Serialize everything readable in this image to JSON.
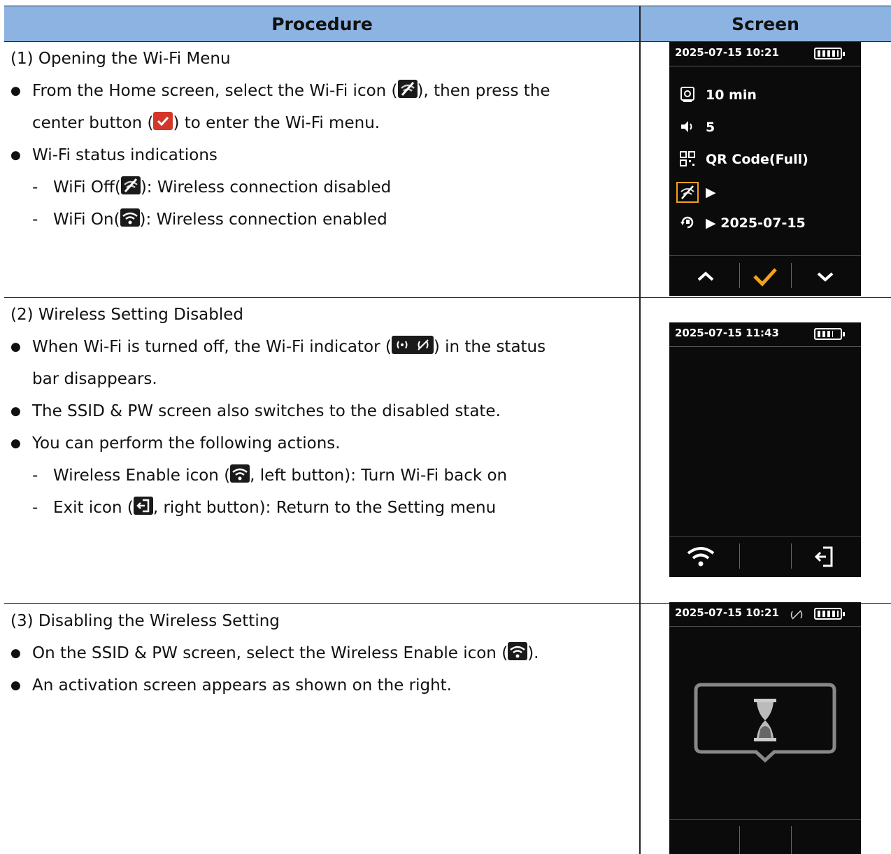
{
  "table": {
    "header_procedure": "Procedure",
    "header_screen": "Screen"
  },
  "sections": [
    {
      "title": "(1) Opening the Wi-Fi Menu",
      "b1_a": "From the Home screen, select the Wi-Fi icon (",
      "b1_b": "), then press the",
      "b1_c": "center button (",
      "b1_d": ") to enter the Wi-Fi menu.",
      "b2": "Wi-Fi status indications",
      "d1_a": "WiFi Off(",
      "d1_b": "): Wireless connection disabled",
      "d2_a": "WiFi On(",
      "d2_b": "): Wireless connection enabled"
    },
    {
      "title": "(2) Wireless Setting Disabled",
      "b1_a": "When Wi-Fi is turned off, the Wi-Fi indicator (",
      "b1_b": ") in the status",
      "b1_c": "bar disappears.",
      "b2": "The SSID & PW screen also switches to the disabled state.",
      "b3": "You can perform the following actions.",
      "d1_a": "Wireless Enable icon (",
      "d1_b": ", left button): Turn Wi-Fi back on",
      "d2_a": "Exit icon (",
      "d2_b": ", right button): Return to the Setting menu"
    },
    {
      "title": "(3) Disabling the Wireless Setting",
      "b1_a": "On the SSID & PW screen, select the Wireless Enable icon (",
      "b1_b": ").",
      "b2": "An activation screen appears as shown on the right."
    }
  ],
  "screens": {
    "s1": {
      "datetime": "2025-07-15 10:21",
      "menu_timeout": "10 min",
      "menu_volume": "5",
      "menu_qr": "QR Code(Full)",
      "menu_date": "2025-07-15"
    },
    "s2": {
      "datetime": "2025-07-15 11:43"
    },
    "s3": {
      "datetime": "2025-07-15 10:21"
    }
  },
  "colors": {
    "header_bg": "#8db3e2",
    "accent": "#f5a21a",
    "device_bg": "#0b0b0b"
  },
  "icons": [
    "wifi-off-icon",
    "center-button-check-icon",
    "wifi-on-icon",
    "wifi-indicator-icon",
    "exit-icon",
    "hourglass-icon"
  ]
}
